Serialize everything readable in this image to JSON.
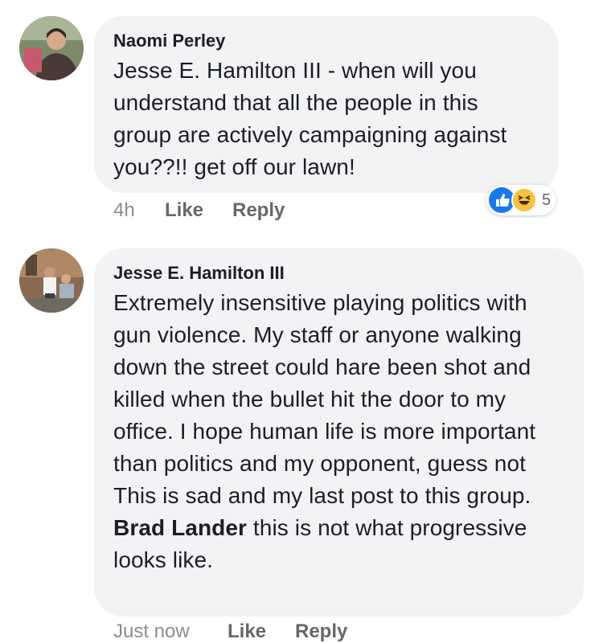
{
  "comments": [
    {
      "author": "Naomi Perley",
      "text": "Jesse E. Hamilton III - when will you understand that all the people in this group are actively campaigning against you??!! get off our lawn!",
      "time": "4h",
      "like_label": "Like",
      "reply_label": "Reply",
      "reactions": {
        "icons": [
          "like-icon",
          "haha-icon"
        ],
        "count": "5"
      }
    },
    {
      "author": "Jesse E. Hamilton III",
      "text_before_mention": "Extremely insensitive playing politics with gun violence. My staff or anyone walking down the street could hare been shot and killed when the bullet hit the door to my office. I hope human life is more important than politics and my opponent, guess not This is sad and my last post to this group.",
      "mention": "Brad Lander",
      "text_after_mention": "this is not what progressive looks like.",
      "time": "Just now",
      "like_label": "Like",
      "reply_label": "Reply"
    }
  ],
  "colors": {
    "bubble": "#f2f3f5",
    "text": "#1c1e21",
    "meta": "#8a8d91",
    "like_blue": "#1877f2",
    "haha_yellow": "#f7c33c"
  }
}
